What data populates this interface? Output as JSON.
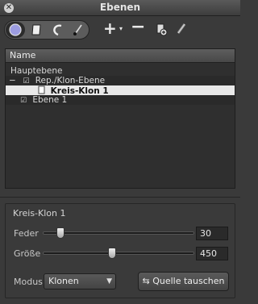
{
  "window": {
    "title": "Ebenen"
  },
  "toolbar": {
    "tools": [
      {
        "name": "circle-mask-tool",
        "icon": "circle-icon",
        "active": true
      },
      {
        "name": "page-mask-tool",
        "icon": "page-icon",
        "active": false
      },
      {
        "name": "curve-mask-tool",
        "icon": "curve-icon",
        "active": false
      },
      {
        "name": "brush-mask-tool",
        "icon": "brush-icon",
        "active": false
      }
    ],
    "add_symbol": "+",
    "add_menu_symbol": "▾",
    "remove_symbol": "−"
  },
  "layers": {
    "header": "Name",
    "rows": [
      {
        "label": "Hauptebene",
        "indent": 0
      },
      {
        "label": "Rep./Klon-Ebene",
        "indent": 1,
        "toggle": "−",
        "check": "☑"
      },
      {
        "label": "Kreis-Klon 1",
        "indent": 3,
        "selected": true
      },
      {
        "label": "Ebene 1",
        "indent": 1,
        "check": "☑"
      }
    ]
  },
  "properties": {
    "title": "Kreis-Klon 1",
    "feather": {
      "label": "Feder",
      "value": "30",
      "slider_fraction": 0.09
    },
    "size": {
      "label": "Größe",
      "value": "450",
      "slider_fraction": 0.45
    },
    "mode": {
      "label": "Modus",
      "value": "Klonen"
    },
    "swap_button": "Quelle tauschen",
    "swap_icon": "⇆"
  }
}
